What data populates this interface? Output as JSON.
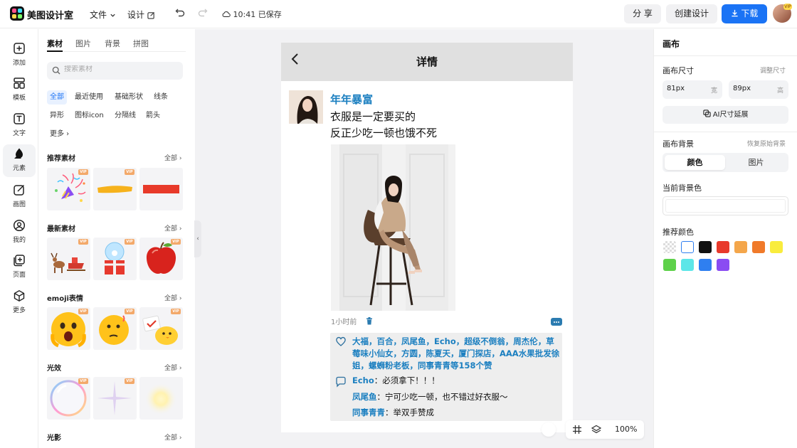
{
  "app": {
    "title": "美图设计室"
  },
  "topbar": {
    "file_menu": "文件",
    "design_menu": "设计",
    "saved_status": "10:41 已保存",
    "share": "分 享",
    "create_design": "创建设计",
    "download": "下载",
    "avatar_badge": "VIP"
  },
  "rail": {
    "items": [
      {
        "label": "添加",
        "icon": "plus-square-icon"
      },
      {
        "label": "模板",
        "icon": "template-icon"
      },
      {
        "label": "文字",
        "icon": "text-icon"
      },
      {
        "label": "元素",
        "icon": "shapes-icon",
        "active": true
      },
      {
        "label": "画图",
        "icon": "draw-icon"
      },
      {
        "label": "我的",
        "icon": "user-icon"
      },
      {
        "label": "页面",
        "icon": "page-add-icon"
      },
      {
        "label": "更多",
        "icon": "cube-icon"
      }
    ]
  },
  "materials": {
    "tabs": [
      "素材",
      "图片",
      "背景",
      "拼图"
    ],
    "search_placeholder": "搜索素材",
    "chips": [
      "全部",
      "最近使用",
      "基础形状",
      "线条",
      "异形",
      "图标icon",
      "分隔线",
      "箭头",
      "更多"
    ],
    "vip_badge": "VIP",
    "all_label": "全部",
    "sections": [
      {
        "title": "推荐素材",
        "thumbs": [
          "party-popper",
          "yellow-brush-stroke",
          "red-bar"
        ]
      },
      {
        "title": "最新素材",
        "thumbs": [
          "reindeer-sleigh",
          "snow-globe-gift",
          "red-apple"
        ]
      },
      {
        "title": "emoji表情",
        "thumbs": [
          "shocked-face",
          "thinking-face",
          "chick-with-sign"
        ]
      },
      {
        "title": "光效",
        "thumbs": [
          "rainbow-bubble",
          "purple-sparkle",
          "soft-glow"
        ]
      },
      {
        "title": "光影",
        "thumbs": []
      }
    ]
  },
  "canvas": {
    "header_title": "详情",
    "post": {
      "name": "年年暴富",
      "lines": [
        "衣服是一定要买的",
        "反正少吃一顿也饿不死"
      ],
      "time": "1小时前",
      "likes": "大福，百合，凤尾鱼，Echo，超级不倒翁，周杰伦，草莓味小仙女，方圆，陈夏天，厦门探店，AAA水果批发徐姐，螺蛳粉老板，同事青青等158个赞",
      "comments": [
        {
          "who": "Echo",
          "sep": "：",
          "text": "必须拿下！！！"
        },
        {
          "who": "凤尾鱼",
          "sep": "：",
          "text": "宁可少吃一顿，也不错过好衣服～"
        },
        {
          "who": "同事青青",
          "sep": "：",
          "text": "举双手赞成"
        }
      ]
    },
    "zoom": "100%"
  },
  "props": {
    "title": "画布",
    "size_label": "画布尺寸",
    "adjust_size": "调整尺寸",
    "width_value": "81px",
    "width_unit": "宽",
    "height_value": "89px",
    "height_unit": "高",
    "ai_extend": "AI尺寸延展",
    "bg_label": "画布背景",
    "restore_bg": "恢复原始背景",
    "bg_options": [
      "颜色",
      "图片"
    ],
    "current_bg_label": "当前背景色",
    "recommend_label": "推荐颜色",
    "swatches": [
      "transparent",
      "#ffffff",
      "#111111",
      "#e8392b",
      "#f4a64b",
      "#f07a2a",
      "#f9ec3d",
      "#5ed14a",
      "#5ce6e8",
      "#2f7ff0",
      "#8a4cf2"
    ]
  }
}
